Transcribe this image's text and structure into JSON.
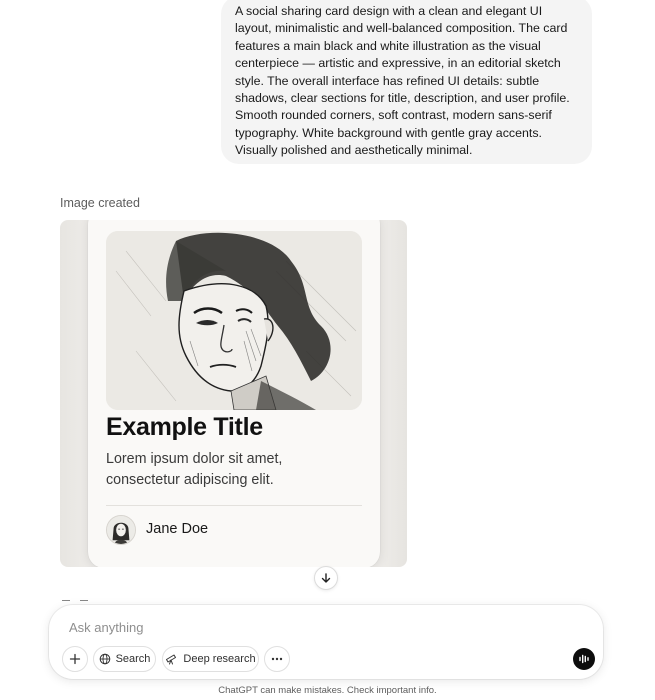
{
  "conversation": {
    "user_message": "A social sharing card design with a clean and elegant UI layout, minimalistic and well-balanced composition. The card features a main black and white illustration as the visual centerpiece — artistic and expressive, in an editorial sketch style. The overall interface has refined UI details: subtle shadows, clear sections for title, description, and user profile. Smooth rounded corners, soft contrast, modern sans-serif typography. White background with gentle gray accents. Visually polished and aesthetically minimal.",
    "status_label": "Image created"
  },
  "generated_card": {
    "title": "Example Title",
    "description": "Lorem ipsum dolor sit amet, consectetur adipiscing elit.",
    "author_name": "Jane Doe",
    "illustration_icon": "sketch-portrait-illustration"
  },
  "composer": {
    "placeholder": "Ask anything",
    "value": "",
    "buttons": {
      "add_icon": "plus-icon",
      "search_label": "Search",
      "search_icon": "globe-icon",
      "research_label": "Deep research",
      "research_icon": "telescope-icon",
      "more_icon": "ellipsis-icon",
      "voice_icon": "voice-waveform-icon"
    }
  },
  "footer": {
    "disclaimer": "ChatGPT can make mistakes. Check important info."
  },
  "colors": {
    "bubble_bg": "#f4f4f4",
    "card_bg": "#faf9f7",
    "image_bg": "#efedea",
    "text_primary": "#0d0d0d",
    "text_secondary": "#5d5d5d"
  }
}
